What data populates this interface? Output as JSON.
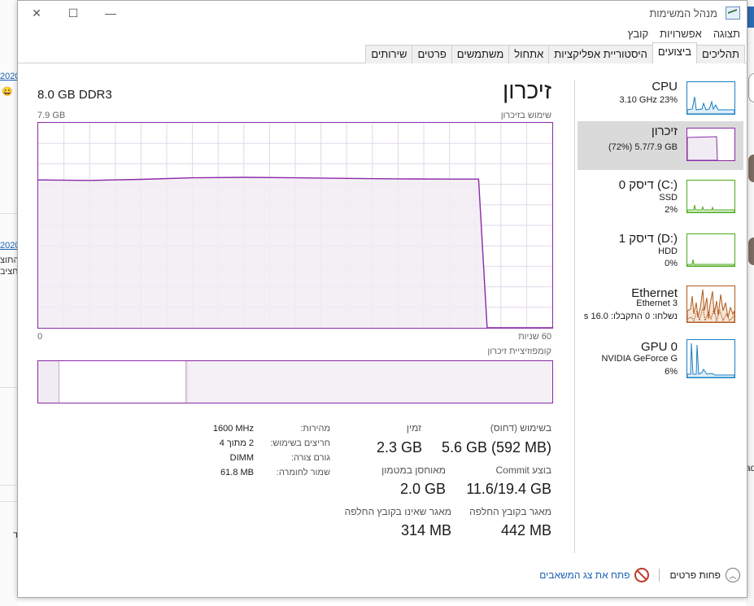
{
  "window": {
    "title": "מנהל המשימות",
    "controls": {
      "minimize": "—",
      "maximize": "☐",
      "close": "✕"
    }
  },
  "menu": [
    "קובץ",
    "אפשרויות",
    "תצוגה"
  ],
  "tabs": [
    "תהליכים",
    "ביצועים",
    "היסטוריית אפליקציות",
    "אתחול",
    "משתמשים",
    "פרטים",
    "שירותים"
  ],
  "active_tab_index": 1,
  "sidebar": [
    {
      "name": "CPU",
      "sub1": "3.10 GHz  23%",
      "sub2": "",
      "color": "#1b7fc2",
      "selected": false
    },
    {
      "name": "זיכרון",
      "sub1": "(72%) 5.7/7.9 GB",
      "sub2": "",
      "color": "#8b29a8",
      "selected": true
    },
    {
      "name": "דיסק 0 (C:)",
      "sub1": "SSD",
      "sub2": "2%",
      "color": "#4caa1e",
      "selected": false
    },
    {
      "name": "דיסק 1 (D:)",
      "sub1": "HDD",
      "sub2": "0%",
      "color": "#4caa1e",
      "selected": false
    },
    {
      "name": "Ethernet",
      "sub1": "Ethernet 3",
      "sub2": "נשלחו: 0 התקבלו: 16.0 s",
      "color": "#b05a1e",
      "selected": false
    },
    {
      "name": "GPU 0",
      "sub1": "NVIDIA GeForce G",
      "sub2": "6%",
      "color": "#1b7fc2",
      "selected": false
    }
  ],
  "main": {
    "title": "זיכרון",
    "spec": "8.0 GB DDR3",
    "graph_max": "7.9 GB",
    "graph_label": "שימוש בזיכרון",
    "axis_left": "0",
    "axis_right": "60 שניות",
    "composition_label": "קומפוזיציית זיכרון"
  },
  "chart_data": {
    "type": "area",
    "title": "שימוש בזיכרון",
    "xlim": [
      60,
      0
    ],
    "ylim": [
      0,
      7.9
    ],
    "x": [
      60,
      54,
      48,
      42,
      36,
      30,
      24,
      18,
      12,
      8.6,
      7.6,
      0
    ],
    "values": [
      5.7,
      5.68,
      5.72,
      5.78,
      5.8,
      5.78,
      5.76,
      5.74,
      5.73,
      5.73,
      0,
      0
    ],
    "grid": true
  },
  "stats": {
    "in_use_label": "בשימוש (דחוס)",
    "in_use_value": "5.6 GB (592 MB)",
    "available_label": "זמין",
    "available_value": "2.3 GB",
    "committed_label": "בוצע Commit",
    "committed_value": "11.6/19.4 GB",
    "cached_label": "מאוחסן במטמון",
    "cached_value": "2.0 GB",
    "paged_label": "מאגר בקובץ החלפה",
    "paged_value": "442 MB",
    "nonpaged_label": "מאגר שאינו בקובץ החלפה",
    "nonpaged_value": "314 MB"
  },
  "hardware": {
    "speed_label": "מהירות:",
    "speed_value": "1600 MHz",
    "slots_label": "חריצים בשימוש:",
    "slots_value": "2 מתוך 4",
    "form_label": "גורם צורה:",
    "form_value": "DIMM",
    "reserved_label": "שמור לחומרה:",
    "reserved_value": "61.8 MB"
  },
  "footer": {
    "fewer_details": "פחות פרטים",
    "open_monitor": "פתח את צג המשאבים"
  },
  "background": {
    "frag1": "2020",
    "frag2": "2020",
    "frag3": "התוצ",
    "frag4": "חציב",
    "frag5": "ד",
    "frag6": "ad"
  }
}
